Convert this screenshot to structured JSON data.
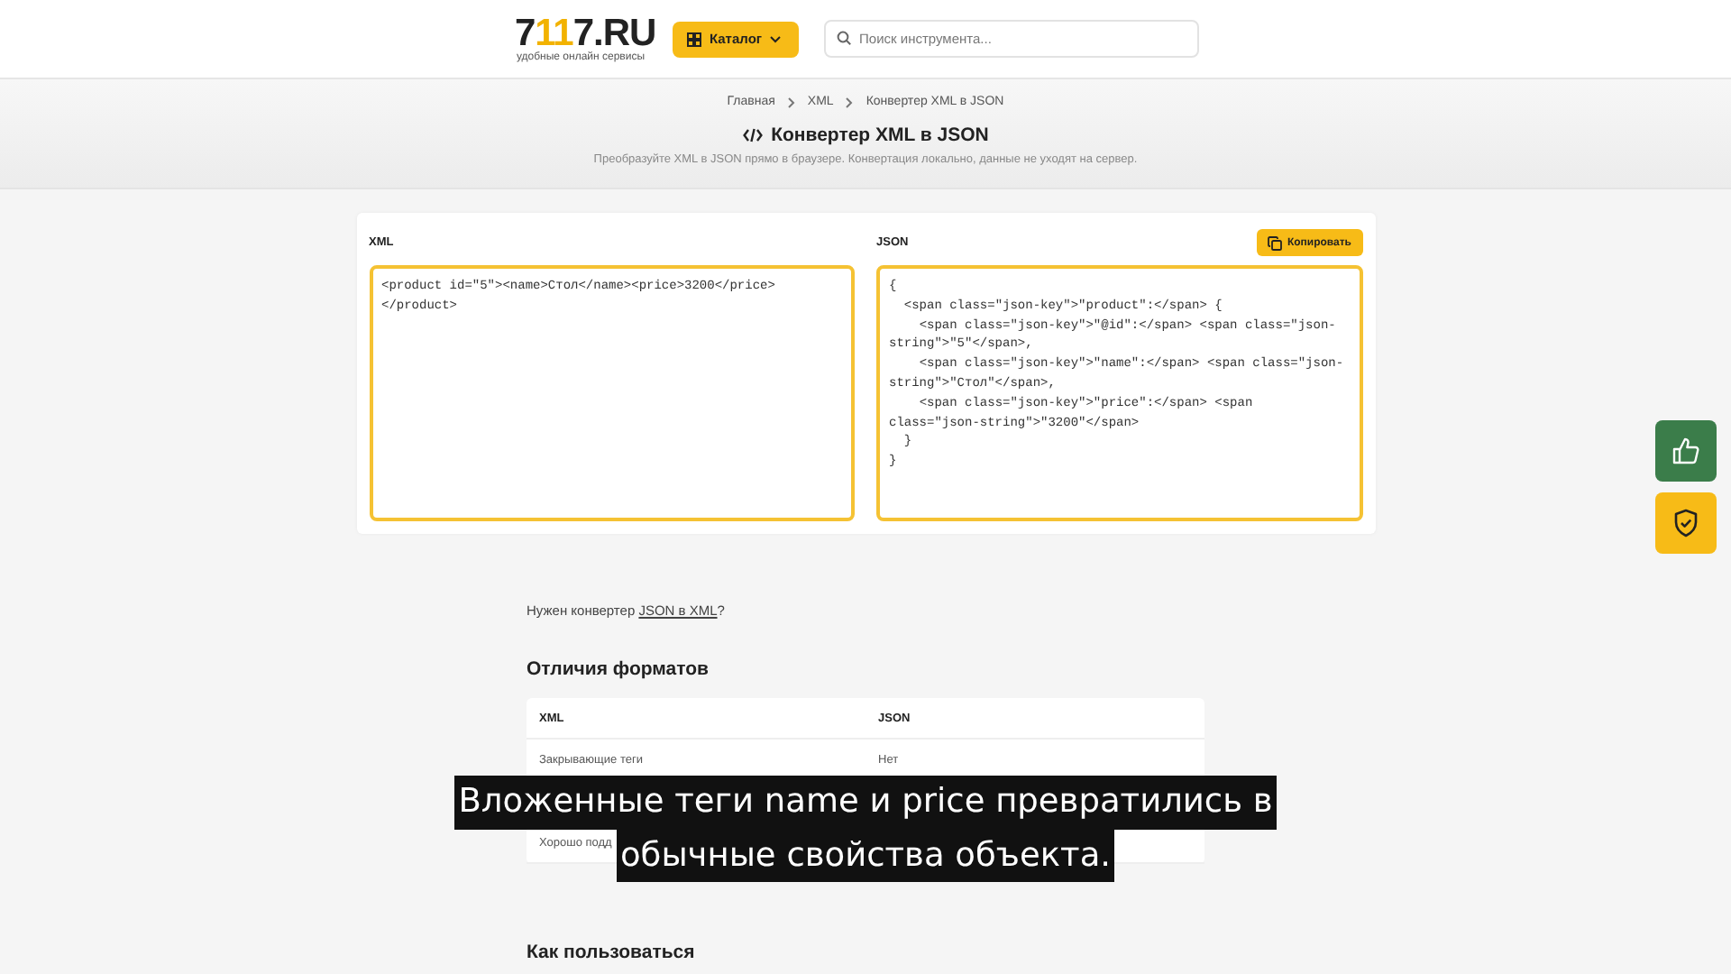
{
  "header": {
    "logo": [
      {
        "text": "7",
        "accent": false
      },
      {
        "text": "11",
        "accent": true
      },
      {
        "text": "7.RU",
        "accent": false
      }
    ],
    "tagline": "удобные онлайн сервисы",
    "catalog_button": "Каталог",
    "search": {
      "placeholder": "Поиск инструмента..."
    }
  },
  "breadcrumbs": [
    "Главная",
    "XML",
    "Конвертер XML в JSON"
  ],
  "page_title": "Конвертер XML в JSON",
  "subtitle_text": "Преобразуйте XML в JSON прямо в браузере. Конвертация локально, данные не уходят на сервер.",
  "converter": {
    "input_label": "XML",
    "input_value": "<product id=\"5\"><name>Стол</name><price>3200</price></product>",
    "output_label": "JSON",
    "copy_button": "Копировать",
    "output_value": "{\n  <span class=\"json-key\">\"product\":</span> {\n    <span class=\"json-key\">\"@id\":</span> <span class=\"json-string\">\"5\"</span>,\n    <span class=\"json-key\">\"name\":</span> <span class=\"json-string\">\"Стол\"</span>,\n    <span class=\"json-key\">\"price\":</span> <span class=\"json-string\">\"3200\"</span>\n  }\n}"
  },
  "note": {
    "before": "Нужен конвертер ",
    "link": "JSON в XML",
    "after": "?"
  },
  "differences": {
    "heading": "Отличия форматов",
    "columns": [
      "XML",
      "JSON"
    ],
    "rows": [
      {
        "cells": [
          "Закрывающие теги",
          "Нет"
        ]
      },
      {
        "cells": [
          "Хорошо подд"
        ]
      }
    ]
  },
  "how_to_heading": "Как пользоваться",
  "caption": [
    "Вложенные теги name и price превратились в",
    "обычные свойства объекта."
  ]
}
